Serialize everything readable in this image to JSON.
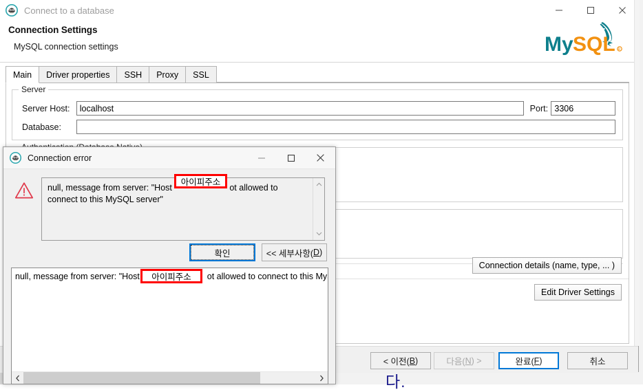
{
  "window": {
    "title": "Connect to a database",
    "icon": "dbeaver-icon",
    "controls": {
      "minimize": "minimize-icon",
      "maximize": "maximize-icon",
      "close": "close-icon"
    }
  },
  "header": {
    "title": "Connection Settings",
    "subtitle": "MySQL connection settings",
    "logo_text_primary": "My",
    "logo_text_secondary": "SQL",
    "logo_mark": "®",
    "colors": {
      "logo_teal": "#0e7f8c",
      "logo_orange": "#f29111",
      "accent_blue": "#0078d7",
      "error_red": "#e03a4c"
    }
  },
  "tabs": [
    {
      "label": "Main",
      "active": true
    },
    {
      "label": "Driver properties",
      "active": false
    },
    {
      "label": "SSH",
      "active": false
    },
    {
      "label": "Proxy",
      "active": false
    },
    {
      "label": "SSL",
      "active": false
    }
  ],
  "main": {
    "server_group": {
      "legend": "Server",
      "host_label": "Server Host:",
      "host_value": "localhost",
      "port_label": "Port:",
      "port_value": "3306",
      "database_label": "Database:",
      "database_value": ""
    },
    "auth_group": {
      "legend": "Authentication (Database Native)"
    },
    "connection_details_button": "Connection details (name, type, ... )",
    "edit_driver_button": "Edit Driver Settings"
  },
  "footer": {
    "prev": "< 이전(B)",
    "prev_plain": "< 이전(",
    "prev_mnemonic": "B",
    "next": "다음(N) >",
    "next_plain": "다음(",
    "next_mnemonic": "N",
    "next_tail": ") >",
    "finish_plain": "완료(",
    "finish_mnemonic": "F",
    "cancel": "취소",
    "paren_close": ")"
  },
  "dialog": {
    "title": "Connection error",
    "icon": "dbeaver-icon",
    "warning_icon": "warning-triangle-icon",
    "controls": {
      "minimize": "minimize-icon",
      "maximize": "maximize-icon",
      "close": "close-icon"
    },
    "message_prefix": "null,  message from server: \"Host ",
    "message_suffix": "ot allowed to connect to this MySQL server\"",
    "message_line1_prefix": "null,  message from server: \"Host ",
    "message_line1_suffix": "ot allowed to",
    "message_line2": "connect to this MySQL server\"",
    "ok_button": "확인",
    "details_button": "<< 세부사항(D)",
    "details_plain": "<< 세부사항(",
    "details_mnemonic": "D",
    "details_text_prefix": "null,  message from server: \"Host '",
    "details_text_suffix": "ot allowed to connect to this MyS",
    "redaction_1": "아이피주소",
    "redaction_2": "아이피주소",
    "redaction_color": "#ff0000"
  },
  "background": {
    "behind_text": "다."
  }
}
